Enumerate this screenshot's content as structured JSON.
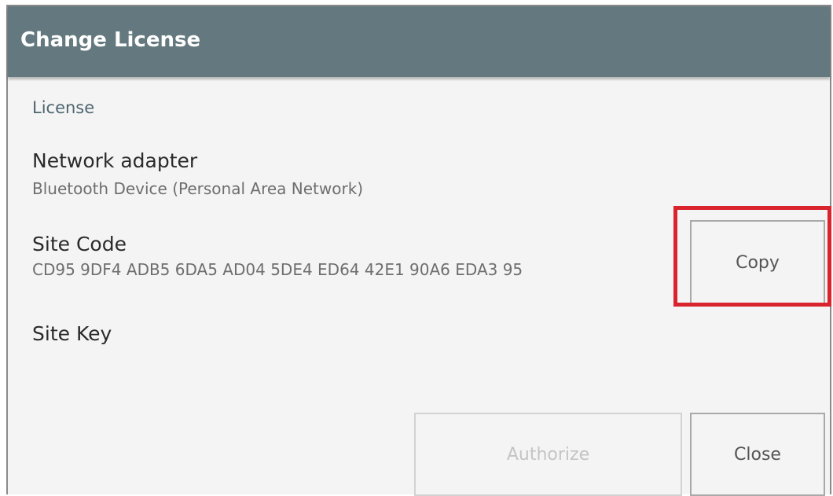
{
  "window": {
    "title": "Change License"
  },
  "license": {
    "section_label": "License",
    "network_adapter_label": "Network adapter",
    "network_adapter_value": "Bluetooth Device (Personal Area Network)",
    "site_code_label": "Site Code",
    "site_code_value": "CD95 9DF4 ADB5 6DA5 AD04 5DE4 ED64 42E1 90A6 EDA3 95",
    "site_key_label": "Site Key"
  },
  "buttons": {
    "copy_label": "Copy",
    "authorize_label": "Authorize",
    "authorize_enabled": false,
    "close_label": "Close"
  },
  "colors": {
    "titlebar": "#64797f",
    "highlight": "#d9232d"
  }
}
